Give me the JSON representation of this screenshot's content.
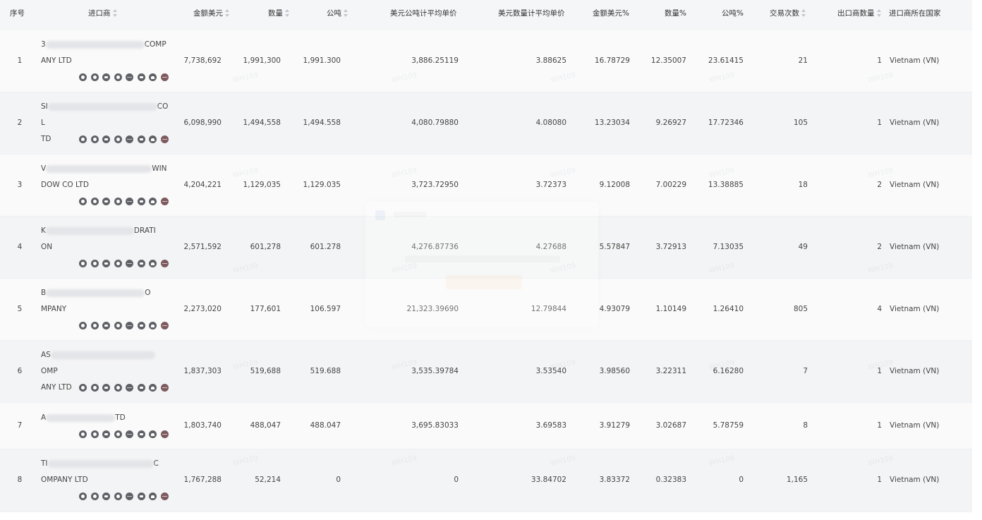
{
  "headers": {
    "index": "序号",
    "importer": "进口商",
    "amount_usd": "金额美元",
    "quantity": "数量",
    "metric_tons": "公吨",
    "usd_per_ton": "美元公吨计平均单价",
    "usd_per_qty": "美元数量计平均单价",
    "amount_pct": "金额美元%",
    "qty_pct": "数量%",
    "ton_pct": "公吨%",
    "trades": "交易次数",
    "exporters": "出口商数量",
    "country": "进口商所在国家"
  },
  "rows": [
    {
      "index": "1",
      "name_start": "3",
      "name_end": "COMP",
      "name_line2": "ANY LTD",
      "amount": "7,738,692",
      "quantity": "1,991,300",
      "tons": "1,991.300",
      "usd_ton": "3,886.25119",
      "usd_qty": "3.88625",
      "amount_pct": "16.78729",
      "qty_pct": "12.35007",
      "ton_pct": "23.61415",
      "trades": "21",
      "exporters": "1",
      "country": "Vietnam (VN)"
    },
    {
      "index": "2",
      "name_start": "SI",
      "name_end": "CO L",
      "name_line2": "TD",
      "amount": "6,098,990",
      "quantity": "1,494,558",
      "tons": "1,494.558",
      "usd_ton": "4,080.79880",
      "usd_qty": "4.08080",
      "amount_pct": "13.23034",
      "qty_pct": "9.26927",
      "ton_pct": "17.72346",
      "trades": "105",
      "exporters": "1",
      "country": "Vietnam (VN)"
    },
    {
      "index": "3",
      "name_start": "V",
      "name_end": "WIN",
      "name_line2": "DOW CO LTD",
      "amount": "4,204,221",
      "quantity": "1,129,035",
      "tons": "1,129.035",
      "usd_ton": "3,723.72950",
      "usd_qty": "3.72373",
      "amount_pct": "9.12008",
      "qty_pct": "7.00229",
      "ton_pct": "13.38885",
      "trades": "18",
      "exporters": "2",
      "country": "Vietnam (VN)"
    },
    {
      "index": "4",
      "name_start": "K",
      "name_end": "DRATI",
      "name_line2": "ON",
      "amount": "2,571,592",
      "quantity": "601,278",
      "tons": "601.278",
      "usd_ton": "4,276.87736",
      "usd_qty": "4.27688",
      "amount_pct": "5.57847",
      "qty_pct": "3.72913",
      "ton_pct": "7.13035",
      "trades": "49",
      "exporters": "2",
      "country": "Vietnam (VN)"
    },
    {
      "index": "5",
      "name_start": "B",
      "name_end": "O",
      "name_line2": "MPANY",
      "amount": "2,273,020",
      "quantity": "177,601",
      "tons": "106.597",
      "usd_ton": "21,323.39690",
      "usd_qty": "12.79844",
      "amount_pct": "4.93079",
      "qty_pct": "1.10149",
      "ton_pct": "1.26410",
      "trades": "805",
      "exporters": "4",
      "country": "Vietnam (VN)"
    },
    {
      "index": "6",
      "name_start": "AS",
      "name_end": "OMP",
      "name_line2": "ANY LTD",
      "amount": "1,837,303",
      "quantity": "519,688",
      "tons": "519.688",
      "usd_ton": "3,535.39784",
      "usd_qty": "3.53540",
      "amount_pct": "3.98560",
      "qty_pct": "3.22311",
      "ton_pct": "6.16280",
      "trades": "7",
      "exporters": "1",
      "country": "Vietnam (VN)"
    },
    {
      "index": "7",
      "name_start": "A",
      "name_end": "TD",
      "name_line2": "",
      "amount": "1,803,740",
      "quantity": "488,047",
      "tons": "488.047",
      "usd_ton": "3,695.83033",
      "usd_qty": "3.69583",
      "amount_pct": "3.91279",
      "qty_pct": "3.02687",
      "ton_pct": "5.78759",
      "trades": "8",
      "exporters": "1",
      "country": "Vietnam (VN)"
    },
    {
      "index": "8",
      "name_start": "TI",
      "name_end": "C",
      "name_line2": "OMPANY LTD",
      "amount": "1,767,288",
      "quantity": "52,214",
      "tons": "0",
      "usd_ton": "0",
      "usd_qty": "33.84702",
      "amount_pct": "3.83372",
      "qty_pct": "0.32383",
      "ton_pct": "0",
      "trades": "1,165",
      "exporters": "1",
      "country": "Vietnam (VN)"
    }
  ],
  "row_icons": [
    "target-icon",
    "compass-icon",
    "bi-icon",
    "circle-icon",
    "globe-icon",
    "ai-icon",
    "people-icon",
    "world-map-icon"
  ],
  "icon_labels": {
    "bi": "BI",
    "ai": "AI"
  },
  "watermark": "WH109",
  "colors": {
    "link": "#2478b4",
    "header_bg": "#f5f6f8",
    "row_odd": "#fafafa",
    "row_even": "#f3f4f5",
    "icon": "#5f6166"
  }
}
